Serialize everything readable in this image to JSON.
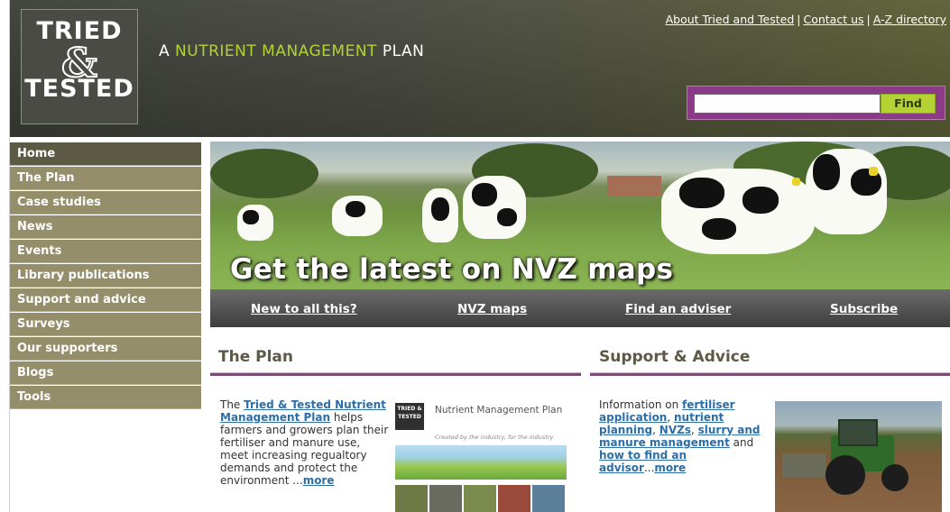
{
  "header": {
    "logo": {
      "line1": "TRIED",
      "line2": "&",
      "line3": "TESTED"
    },
    "tagline": {
      "part1": "A ",
      "part2": "NUTRIENT MANAGEMENT",
      "part3": " PLAN"
    },
    "top_links": [
      "About Tried and Tested",
      "Contact us",
      "A-Z directory"
    ],
    "search": {
      "value": "",
      "button": "Find"
    },
    "colors": {
      "accent_green": "#b5d233",
      "search_purple": "#8a3a86",
      "header_dark": "#3a3d36"
    }
  },
  "nav": {
    "items": [
      "Home",
      "The Plan",
      "Case studies",
      "News",
      "Events",
      "Library publications",
      "Support and advice",
      "Surveys",
      "Our supporters",
      "Blogs",
      "Tools"
    ],
    "active": "Home"
  },
  "hero": {
    "title": "Get the latest on NVZ maps",
    "links": [
      "New to all this?",
      "NVZ maps",
      "Find an adviser",
      "Subscribe"
    ]
  },
  "plan": {
    "title": "The Plan",
    "text_prefix": "The ",
    "link1": "Tried & Tested Nutrient Management Plan",
    "text_body": " helps farmers and growers plan their fertiliser and manure use, meet increasing regualtory demands and protect the environment ...",
    "more": "more",
    "brochure": {
      "logo": "TRIED & TESTED",
      "title": "Nutrient Management Plan",
      "subtitle": "Created by the industry, for the industry"
    }
  },
  "support": {
    "title": "Support & Advice",
    "text_prefix": "Information on ",
    "link1": "fertiliser application",
    "sep1": ", ",
    "link2": "nutrient planning",
    "sep2": ", ",
    "link3": "NVZs",
    "sep3": ", ",
    "link4": "slurry and manure management",
    "sep4": " and ",
    "link5": "how to find an advisor",
    "ellipsis": "...",
    "more": "more"
  }
}
